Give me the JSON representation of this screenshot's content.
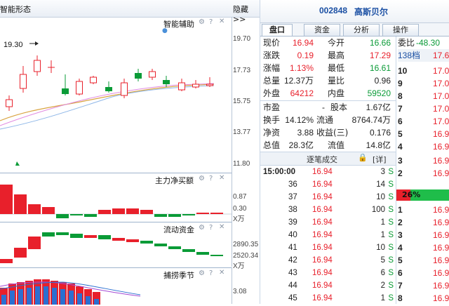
{
  "chart": {
    "header_title": "智能形态",
    "hide_label": "隐藏>>",
    "smart_assist_label": "智能辅助",
    "price_annotation": "19.30",
    "price_ticks": [
      "19.70",
      "17.73",
      "15.75",
      "13.77",
      "11.80"
    ],
    "panel2_title": "主力净买额",
    "panel2_ticks": [
      "0.87",
      "0.30"
    ],
    "panel2_unit": "X万",
    "panel3_title": "流动资金",
    "panel3_ticks": [
      "2890.35",
      "2520.34"
    ],
    "panel3_unit": "X万",
    "panel4_title": "捕捞季节",
    "panel4_ticks": [
      "3.08"
    ],
    "colors": {
      "up": "#e8202b",
      "down": "#0a9b37",
      "ma": "#d9a441"
    }
  },
  "stock": {
    "code": "002848",
    "name": "高斯贝尔"
  },
  "tabs": [
    "盘口",
    "资金",
    "分析",
    "操作"
  ],
  "quote": {
    "rows": [
      {
        "l1": "现价",
        "v1": "16.94",
        "c1": "red",
        "l2": "今开",
        "v2": "16.66",
        "c2": "green"
      },
      {
        "l1": "涨跌",
        "v1": "0.19",
        "c1": "red",
        "l2": "最高",
        "v2": "17.29",
        "c2": "red"
      },
      {
        "l1": "涨幅",
        "v1": "1.13%",
        "c1": "red",
        "l2": "最低",
        "v2": "16.61",
        "c2": "green"
      },
      {
        "l1": "总量",
        "v1": "12.37万",
        "c1": "",
        "l2": "量比",
        "v2": "0.96",
        "c2": ""
      },
      {
        "l1": "外盘",
        "v1": "64212",
        "c1": "red",
        "l2": "内盘",
        "v2": "59520",
        "c2": "green"
      }
    ],
    "rows2": [
      {
        "l1": "市盈",
        "v1": "-",
        "c1": "",
        "l2": "股本",
        "v2": "1.67亿",
        "c2": ""
      },
      {
        "l1": "换手",
        "v1": "14.12%",
        "c1": "",
        "l2": "流通",
        "v2": "8764.74万",
        "c2": ""
      },
      {
        "l1": "净资",
        "v1": "3.88",
        "c1": "",
        "l2": "收益(三)",
        "v2": "0.176",
        "c2": ""
      },
      {
        "l1": "总值",
        "v1": "28.3亿",
        "c1": "",
        "l2": "流值",
        "v2": "14.8亿",
        "c2": ""
      }
    ]
  },
  "trades": {
    "title": "逐笔成交",
    "detail_label": "[详]",
    "rows": [
      {
        "t": "15:00:00",
        "p": "16.94",
        "v": "3",
        "s": "S"
      },
      {
        "t": "36",
        "p": "16.94",
        "v": "14",
        "s": "S"
      },
      {
        "t": "37",
        "p": "16.94",
        "v": "10",
        "s": "S"
      },
      {
        "t": "38",
        "p": "16.94",
        "v": "100",
        "s": "S"
      },
      {
        "t": "39",
        "p": "16.94",
        "v": "1",
        "s": "S"
      },
      {
        "t": "40",
        "p": "16.94",
        "v": "1",
        "s": "S"
      },
      {
        "t": "41",
        "p": "16.94",
        "v": "10",
        "s": "S"
      },
      {
        "t": "42",
        "p": "16.94",
        "v": "5",
        "s": "S"
      },
      {
        "t": "43",
        "p": "16.94",
        "v": "6",
        "s": "S"
      },
      {
        "t": "44",
        "p": "16.94",
        "v": "2",
        "s": "S"
      },
      {
        "t": "45",
        "p": "16.94",
        "v": "1",
        "s": "S"
      }
    ]
  },
  "book": {
    "ratio_label": "委比",
    "ratio_value": "-48.30",
    "count_label": "138档",
    "count_value": "17.6",
    "asks": [
      {
        "n": "10",
        "p": "17.0"
      },
      {
        "n": "9",
        "p": "17.0"
      },
      {
        "n": "8",
        "p": "17.0"
      },
      {
        "n": "7",
        "p": "17.0"
      },
      {
        "n": "6",
        "p": "17.0"
      },
      {
        "n": "5",
        "p": "16.9"
      },
      {
        "n": "4",
        "p": "16.9"
      },
      {
        "n": "3",
        "p": "16.9"
      },
      {
        "n": "2",
        "p": "16.9"
      }
    ],
    "bar_pct": "26%",
    "bids": [
      {
        "n": "1",
        "p": "16.9"
      },
      {
        "n": "2",
        "p": "16.9"
      },
      {
        "n": "3",
        "p": "16.9"
      },
      {
        "n": "4",
        "p": "16.9"
      },
      {
        "n": "5",
        "p": "16.9"
      },
      {
        "n": "6",
        "p": "16.9"
      },
      {
        "n": "7",
        "p": "16.9"
      },
      {
        "n": "8",
        "p": "16.9"
      }
    ]
  }
}
